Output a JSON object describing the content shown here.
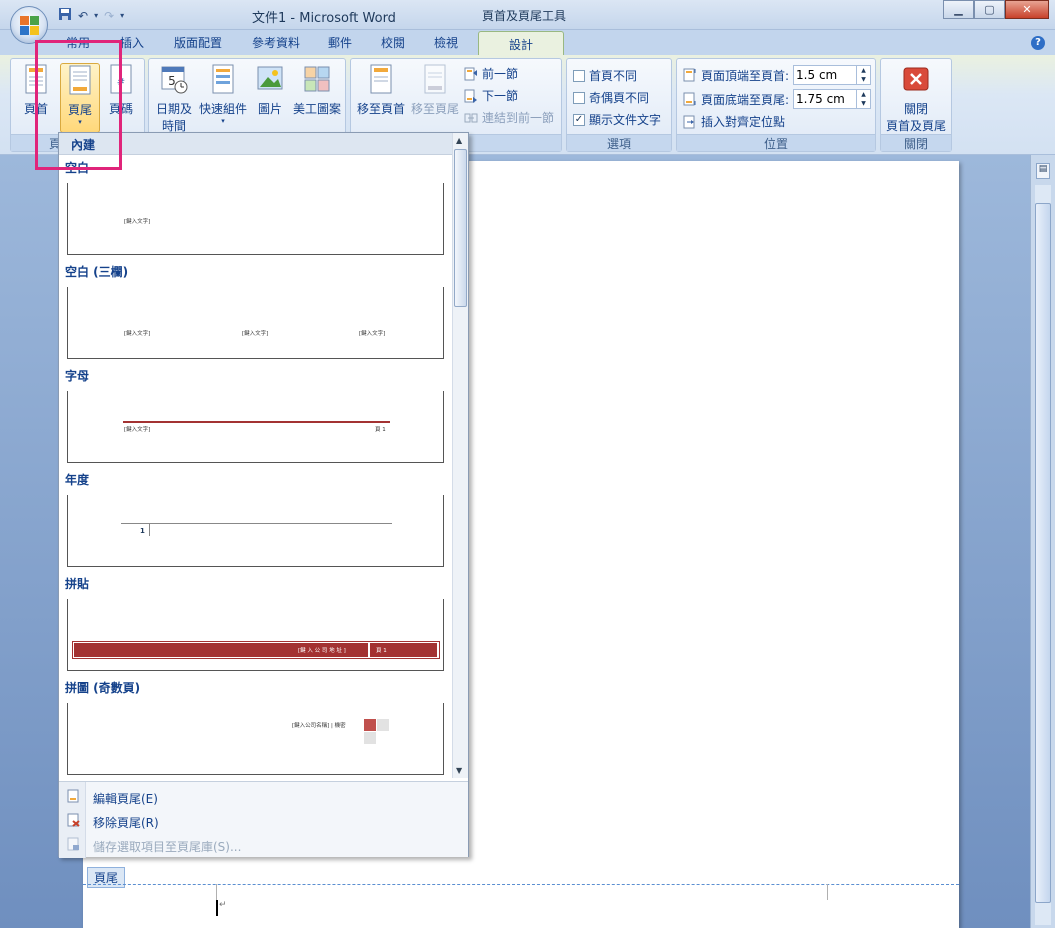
{
  "window": {
    "title": "文件1 - Microsoft Word",
    "contextual_title": "頁首及頁尾工具",
    "controls": [
      "▁",
      "▢",
      "✕"
    ]
  },
  "tabs": [
    {
      "label": "常用"
    },
    {
      "label": "插入"
    },
    {
      "label": "版面配置"
    },
    {
      "label": "參考資料"
    },
    {
      "label": "郵件"
    },
    {
      "label": "校閱"
    },
    {
      "label": "檢視"
    },
    {
      "label": "設計",
      "active": true
    }
  ],
  "ribbon": {
    "group1": {
      "label": "頁",
      "header": "頁首",
      "footer": "頁尾",
      "page_number": "頁碼"
    },
    "insert": {
      "datetime_line1": "日期及",
      "datetime_line2": "時間",
      "quickparts": "快速組件",
      "picture": "圖片",
      "clipart": "美工圖案"
    },
    "nav": {
      "goto_header": "移至頁首",
      "goto_footer": "移至頁尾",
      "prev": "前一節",
      "next": "下一節",
      "link": "連結到前一節"
    },
    "options": {
      "label": "選項",
      "first_page": "首頁不同",
      "odd_even": "奇偶頁不同",
      "show_text": "顯示文件文字",
      "show_text_checked": true
    },
    "position": {
      "label": "位置",
      "header_from_top": "頁面頂端至頁首:",
      "header_value": "1.5 cm",
      "footer_from_bottom": "頁面底端至頁尾:",
      "footer_value": "1.75 cm",
      "align_tab": "插入對齊定位點"
    },
    "close": {
      "label": "關閉",
      "button_line1": "關閉",
      "button_line2": "頁首及頁尾"
    }
  },
  "gallery": {
    "section": "內建",
    "items": [
      {
        "name": "空白",
        "texts": [
          "[鍵入文字]"
        ]
      },
      {
        "name": "空白 (三欄)",
        "texts": [
          "[鍵入文字]",
          "[鍵入文字]",
          "[鍵入文字]"
        ]
      },
      {
        "name": "字母",
        "texts": [
          "[鍵入文字]",
          "頁 1"
        ]
      },
      {
        "name": "年度",
        "texts": [
          "1"
        ]
      },
      {
        "name": "拼貼",
        "texts": [
          "[鍵 入 公 司 地 址 ]",
          "頁 1"
        ]
      },
      {
        "name": "拼圖 (奇數頁)",
        "texts": [
          "[鍵入公司名稱] | 機密"
        ]
      }
    ],
    "menu": {
      "edit": "編輯頁尾(E)",
      "remove": "移除頁尾(R)",
      "save": "儲存選取項目至頁尾庫(S)..."
    }
  },
  "document": {
    "footer_tag": "頁尾",
    "paragraph_mark": "↵"
  },
  "colors": {
    "accent_red": "#a33232",
    "highlight": "#e0247a"
  }
}
